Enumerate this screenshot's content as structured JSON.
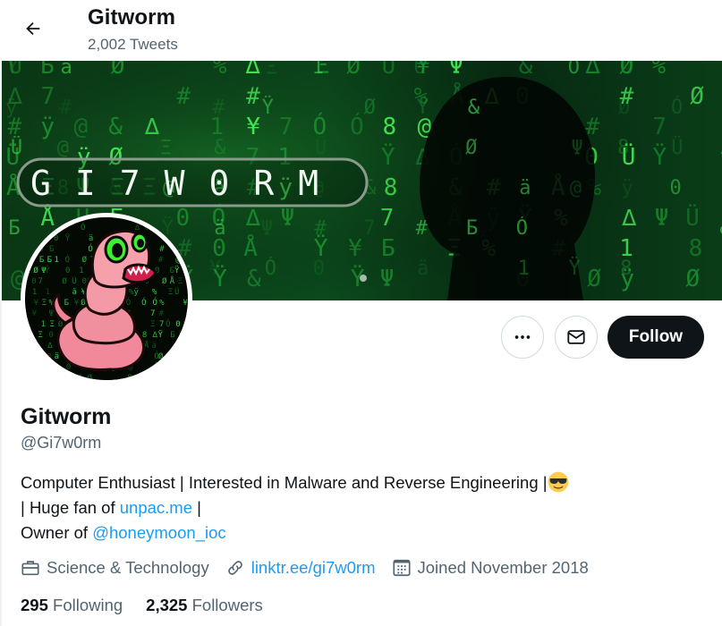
{
  "header": {
    "title": "Gitworm",
    "tweet_count": "2,002 Tweets",
    "back_icon": "arrow-left-icon"
  },
  "banner": {
    "text": "GI7W0RM",
    "description": "Green matrix code rain with hooded silhouette"
  },
  "avatar": {
    "description": "Pink cartoon worm with green eyes on matrix background"
  },
  "actions": {
    "more_icon": "more-horizontal-icon",
    "message_icon": "envelope-icon",
    "follow_label": "Follow"
  },
  "profile": {
    "display_name": "Gitworm",
    "handle": "@Gi7w0rm",
    "bio": {
      "line1": "Computer Enthusiast | Interested in Malware and Reverse Engineering |",
      "line1_emoji": "smiling-face-with-sunglasses",
      "line2_prefix": "| Huge fan of ",
      "line2_link": "unpac.me",
      "line2_suffix": " |",
      "line3_prefix": "Owner of ",
      "line3_link": "@honeymoon_ioc"
    },
    "meta": {
      "category_icon": "briefcase-icon",
      "category": "Science & Technology",
      "link_icon": "link-icon",
      "website": "linktr.ee/gi7w0rm",
      "joined_icon": "calendar-icon",
      "joined": "Joined November 2018"
    },
    "stats": {
      "following_count": "295",
      "following_label": "Following",
      "followers_count": "2,325",
      "followers_label": "Followers"
    }
  },
  "colors": {
    "text_primary": "#0f1419",
    "text_secondary": "#536471",
    "link": "#1d9bf0",
    "follow_bg": "#0f1419",
    "border": "#cfd9de"
  }
}
